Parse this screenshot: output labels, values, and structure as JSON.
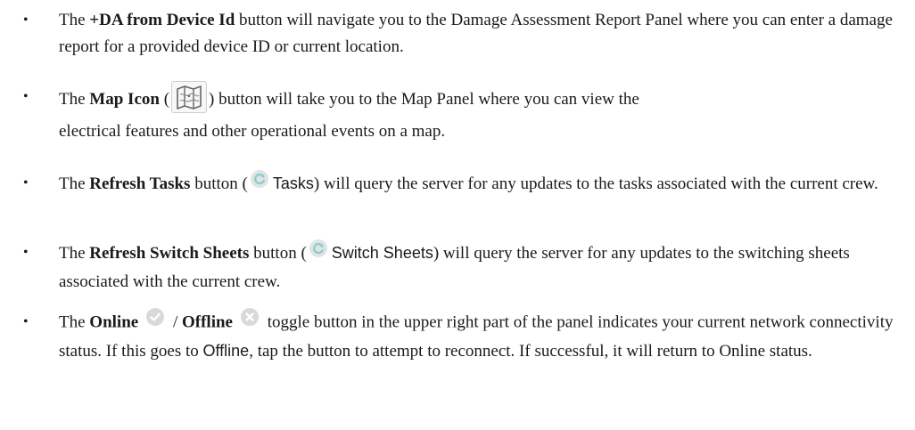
{
  "bullets": [
    {
      "symbol": "•",
      "pre": "The ",
      "bold": "+DA from Device Id",
      "post": " button will navigate you to the Damage Assessment Report Panel where you can enter a damage report for a provided device ID or current location."
    },
    {
      "symbol": "•",
      "pre": "The ",
      "bold": "Map Icon",
      "open_paren": " (",
      "icon": "map-icon",
      "post_line1": ") button will take you to the Map Panel where you can view the",
      "post_line2": "electrical features and other operational events on a map."
    },
    {
      "symbol": "•",
      "pre": "The ",
      "bold": "Refresh Tasks",
      "mid": " button (",
      "icon": "refresh-icon",
      "sans_label": "Tasks",
      "post": ") will query the server for any updates to the tasks associated with the current crew."
    },
    {
      "symbol": "•",
      "pre": "The ",
      "bold": "Refresh Switch Sheets",
      "mid": " button (",
      "icon": "refresh-icon",
      "sans_label": "Switch Sheets",
      "post": ") will query the server for any updates to the switching sheets associated with the current crew."
    },
    {
      "symbol": "•",
      "pre": "The ",
      "bold_online": "Online",
      "online_icon": "check-circle-icon",
      "slash": " / ",
      "bold_offline": "Offline",
      "offline_icon": "x-circle-icon",
      "post1": " toggle button in the upper right part of the panel indicates your current network connectivity status. If this goes to ",
      "sans_offline": "Offline",
      "post2": ", tap the button to attempt to reconnect. If successful, it will return to Online status."
    }
  ],
  "colors": {
    "icon_circle": "#d9d9d9",
    "icon_glyph": "#ffffff",
    "refresh_arc": "#7fd0d0",
    "map_stroke": "#666666"
  }
}
